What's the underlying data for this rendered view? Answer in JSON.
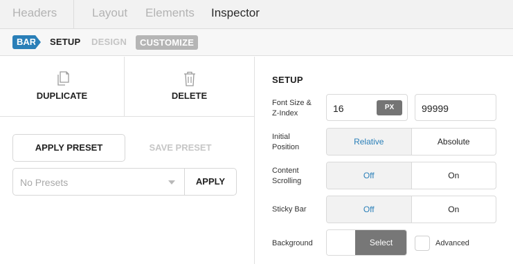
{
  "topbar": {
    "tabs": [
      {
        "label": "Headers"
      },
      {
        "label": "Layout"
      },
      {
        "label": "Elements"
      },
      {
        "label": "Inspector"
      }
    ]
  },
  "breadcrumb": {
    "bar": "BAR",
    "setup": "SETUP",
    "design": "DESIGN",
    "customize": "CUSTOMIZE"
  },
  "left": {
    "duplicate_label": "DUPLICATE",
    "delete_label": "DELETE",
    "apply_preset_label": "APPLY PRESET",
    "save_preset_label": "SAVE PRESET",
    "preset_select_value": "No Presets",
    "apply_label": "APPLY"
  },
  "setup": {
    "title": "SETUP",
    "font_size_label_1": "Font Size &",
    "font_size_label_2": "Z-Index",
    "font_size_value": "16",
    "font_size_unit": "PX",
    "z_index_value": "99999",
    "position_label_1": "Initial",
    "position_label_2": "Position",
    "position_options": [
      "Relative",
      "Absolute"
    ],
    "position_selected": "Relative",
    "scrolling_label_1": "Content",
    "scrolling_label_2": "Scrolling",
    "scrolling_options": [
      "Off",
      "On"
    ],
    "scrolling_selected": "Off",
    "sticky_label": "Sticky Bar",
    "sticky_options": [
      "Off",
      "On"
    ],
    "sticky_selected": "Off",
    "background_label": "Background",
    "background_select_label": "Select",
    "advanced_label": "Advanced",
    "advanced_checked": false
  },
  "colors": {
    "accent": "#2a7fb8",
    "px_tag": "#747474",
    "select_button": "#777777"
  }
}
